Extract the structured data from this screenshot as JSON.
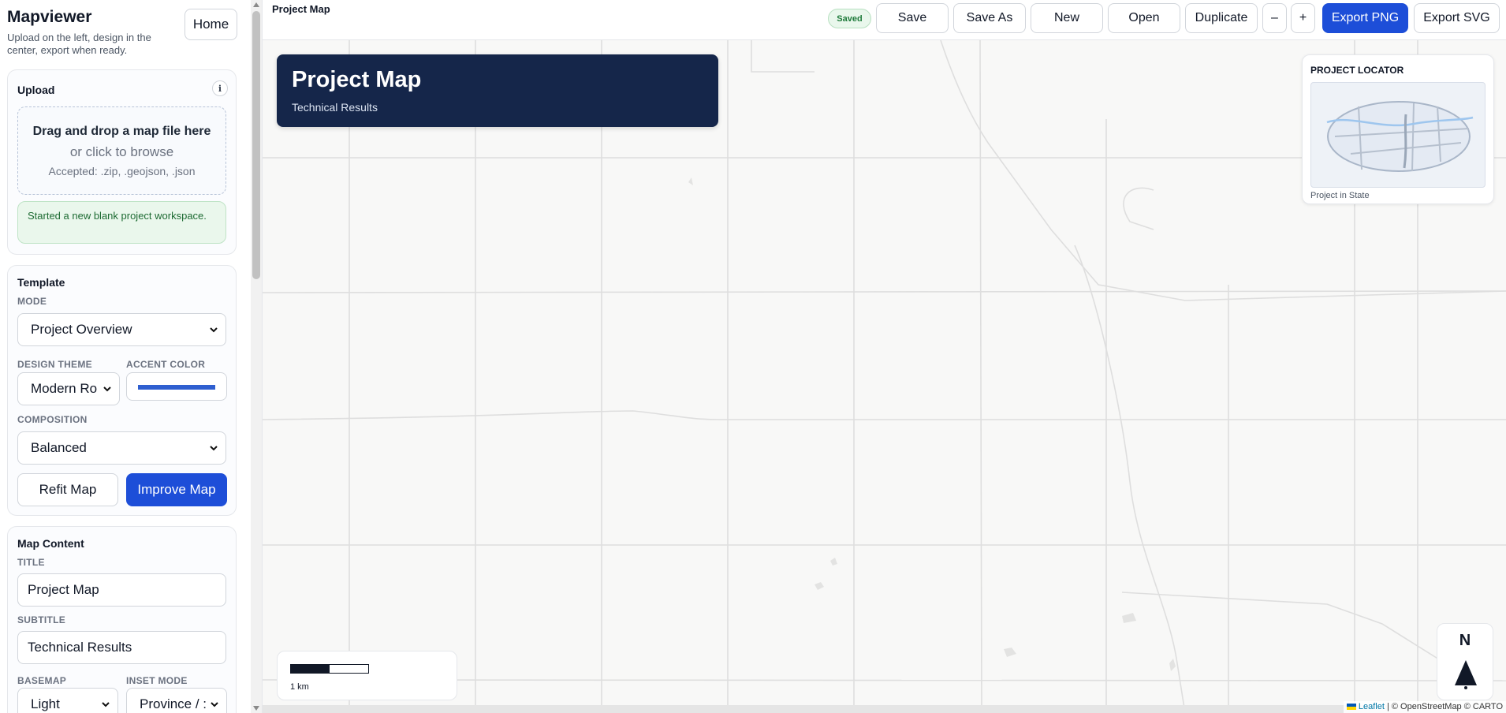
{
  "app": {
    "name": "Mapviewer",
    "tagline": "Upload on the left, design in the center, export when ready.",
    "home_label": "Home"
  },
  "upload": {
    "title": "Upload",
    "info_label": "i",
    "drop_main": "Drag and drop a map file here",
    "drop_sub": "or click to browse",
    "accepted": "Accepted: .zip, .geojson, .json",
    "notice": "Started a new blank project workspace."
  },
  "template": {
    "title": "Template",
    "mode_label": "MODE",
    "mode_value": "Project Overview",
    "theme_label": "DESIGN THEME",
    "theme_value": "Modern Ro",
    "accent_label": "ACCENT COLOR",
    "accent_color": "#2f5fd0",
    "composition_label": "COMPOSITION",
    "composition_value": "Balanced",
    "refit_label": "Refit Map",
    "improve_label": "Improve Map"
  },
  "content": {
    "title": "Map Content",
    "title_label": "TITLE",
    "title_value": "Project Map",
    "subtitle_label": "SUBTITLE",
    "subtitle_value": "Technical Results",
    "basemap_label": "BASEMAP",
    "basemap_value": "Light",
    "inset_label": "INSET MODE",
    "inset_value": "Province / :"
  },
  "toolbar": {
    "crumb": "Project Map",
    "saved": "Saved",
    "save": "Save",
    "save_as": "Save As",
    "new": "New",
    "open": "Open",
    "duplicate": "Duplicate",
    "zoom_out": "–",
    "zoom_in": "+",
    "export_png": "Export PNG",
    "export_svg": "Export SVG"
  },
  "map": {
    "title": "Project Map",
    "subtitle": "Technical Results",
    "locator_title": "PROJECT LOCATOR",
    "locator_caption": "Project in State",
    "scale_label": "1 km",
    "north_label": "N",
    "attribution_leaflet": "Leaflet",
    "attribution_rest": " | © OpenStreetMap © CARTO"
  },
  "colors": {
    "primary": "#1d4ed8",
    "title_card": "#15264a",
    "map_bg": "#f8f8f7",
    "road": "#dcdcda"
  }
}
